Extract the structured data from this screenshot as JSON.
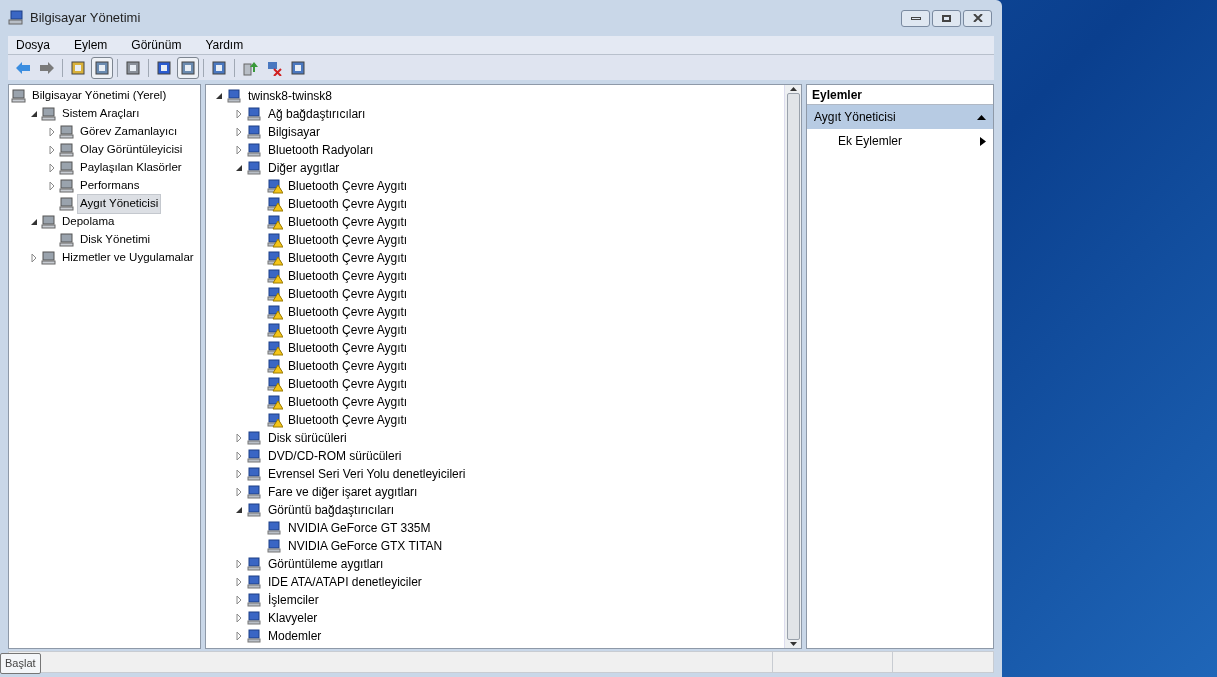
{
  "window": {
    "title": "Bilgisayar Yönetimi"
  },
  "menu": [
    "Dosya",
    "Eylem",
    "Görünüm",
    "Yardım"
  ],
  "toolbar": [
    {
      "kind": "back",
      "pressed": false
    },
    {
      "kind": "forward",
      "pressed": false
    },
    {
      "kind": "separator"
    },
    {
      "kind": "up",
      "pressed": false
    },
    {
      "kind": "tree",
      "pressed": true
    },
    {
      "kind": "separator"
    },
    {
      "kind": "list",
      "pressed": false
    },
    {
      "kind": "separator"
    },
    {
      "kind": "help",
      "pressed": false
    },
    {
      "kind": "pane",
      "pressed": true
    },
    {
      "kind": "separator"
    },
    {
      "kind": "scan",
      "pressed": false
    },
    {
      "kind": "separator"
    },
    {
      "kind": "update",
      "pressed": false
    },
    {
      "kind": "remove",
      "pressed": false
    },
    {
      "kind": "disable",
      "pressed": false
    }
  ],
  "console_tree": [
    {
      "label": "Bilgisayar Yönetimi (Yerel)",
      "selected": false,
      "children": [
        {
          "label": "Sistem Araçları",
          "selected": false,
          "expanded": true,
          "children": [
            {
              "label": "Görev Zamanlayıcı",
              "selected": false,
              "expanded": false
            },
            {
              "label": "Olay Görüntüleyicisi",
              "selected": false,
              "expanded": false
            },
            {
              "label": "Paylaşılan Klasörler",
              "selected": false,
              "expanded": false
            },
            {
              "label": "Performans",
              "selected": false,
              "expanded": false
            },
            {
              "label": "Aygıt Yöneticisi",
              "selected": true
            }
          ]
        },
        {
          "label": "Depolama",
          "selected": false,
          "expanded": true,
          "children": [
            {
              "label": "Disk Yönetimi",
              "selected": false
            }
          ]
        },
        {
          "label": "Hizmetler ve Uygulamalar",
          "selected": false,
          "expanded": false
        }
      ]
    }
  ],
  "device_tree": [
    {
      "label": "twinsk8-twinsk8",
      "expanded": true,
      "warning": false,
      "children": [
        {
          "label": "Ağ bağdaştırıcıları",
          "expanded": false,
          "warning": false
        },
        {
          "label": "Bilgisayar",
          "expanded": false,
          "warning": false
        },
        {
          "label": "Bluetooth Radyoları",
          "expanded": false,
          "warning": false
        },
        {
          "label": "Diğer aygıtlar",
          "expanded": true,
          "warning": false,
          "children": [
            {
              "label": "Bluetooth Çevre Aygıtı",
              "warning": true
            },
            {
              "label": "Bluetooth Çevre Aygıtı",
              "warning": true
            },
            {
              "label": "Bluetooth Çevre Aygıtı",
              "warning": true
            },
            {
              "label": "Bluetooth Çevre Aygıtı",
              "warning": true
            },
            {
              "label": "Bluetooth Çevre Aygıtı",
              "warning": true
            },
            {
              "label": "Bluetooth Çevre Aygıtı",
              "warning": true
            },
            {
              "label": "Bluetooth Çevre Aygıtı",
              "warning": true
            },
            {
              "label": "Bluetooth Çevre Aygıtı",
              "warning": true
            },
            {
              "label": "Bluetooth Çevre Aygıtı",
              "warning": true
            },
            {
              "label": "Bluetooth Çevre Aygıtı",
              "warning": true
            },
            {
              "label": "Bluetooth Çevre Aygıtı",
              "warning": true
            },
            {
              "label": "Bluetooth Çevre Aygıtı",
              "warning": true
            },
            {
              "label": "Bluetooth Çevre Aygıtı",
              "warning": true
            },
            {
              "label": "Bluetooth Çevre Aygıtı",
              "warning": true
            }
          ]
        },
        {
          "label": "Disk sürücüleri",
          "expanded": false,
          "warning": false
        },
        {
          "label": "DVD/CD-ROM sürücüleri",
          "expanded": false,
          "warning": false
        },
        {
          "label": "Evrensel Seri Veri Yolu denetleyicileri",
          "expanded": false,
          "warning": false
        },
        {
          "label": "Fare ve diğer işaret aygıtları",
          "expanded": false,
          "warning": false
        },
        {
          "label": "Görüntü bağdaştırıcıları",
          "expanded": true,
          "warning": false,
          "children": [
            {
              "label": "NVIDIA GeForce GT 335M",
              "warning": false
            },
            {
              "label": "NVIDIA GeForce GTX TITAN",
              "warning": false
            }
          ]
        },
        {
          "label": "Görüntüleme aygıtları",
          "expanded": false,
          "warning": false
        },
        {
          "label": "IDE ATA/ATAPI denetleyiciler",
          "expanded": false,
          "warning": false
        },
        {
          "label": "İşlemciler",
          "expanded": false,
          "warning": false
        },
        {
          "label": "Klavyeler",
          "expanded": false,
          "warning": false
        },
        {
          "label": "Modemler",
          "expanded": false,
          "warning": false
        }
      ]
    }
  ],
  "actions": {
    "title": "Eylemler",
    "sections": [
      {
        "title": "Aygıt Yöneticisi",
        "expanded": true,
        "items": [
          "Ek Eylemler"
        ]
      }
    ]
  },
  "tooltip": "Başlat"
}
